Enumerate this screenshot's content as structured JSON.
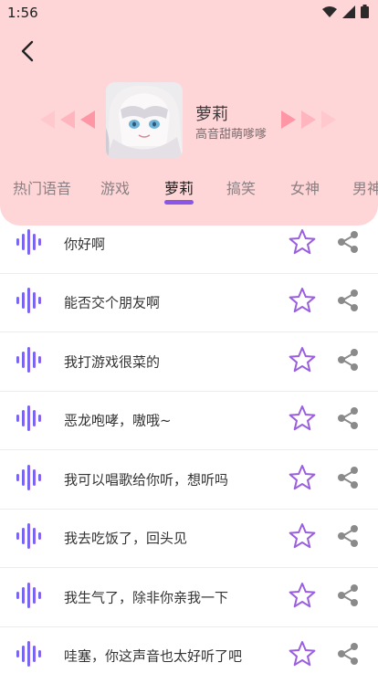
{
  "status_bar": {
    "time": "1:56"
  },
  "character": {
    "name": "萝莉",
    "description": "高音甜萌嗲嗲"
  },
  "tabs": [
    {
      "label": "热门语音"
    },
    {
      "label": "游戏"
    },
    {
      "label": "萝莉"
    },
    {
      "label": "搞笑"
    },
    {
      "label": "女神"
    },
    {
      "label": "男神"
    }
  ],
  "active_tab": "萝莉",
  "colors": {
    "header_bg": "#ffd6d8",
    "accent": "#8a56e8",
    "deco_arrows": "#ff8fa0"
  },
  "voices": [
    {
      "text": "你好啊"
    },
    {
      "text": "能否交个朋友啊"
    },
    {
      "text": "我打游戏很菜的"
    },
    {
      "text": "恶龙咆哮，嗷哦~"
    },
    {
      "text": "我可以唱歌给你听，想听吗"
    },
    {
      "text": "我去吃饭了，回头见"
    },
    {
      "text": "我生气了，除非你亲我一下"
    },
    {
      "text": "哇塞，你这声音也太好听了吧"
    }
  ]
}
